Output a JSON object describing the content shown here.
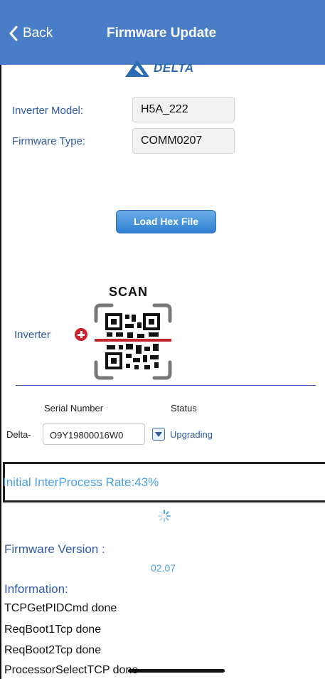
{
  "nav": {
    "back_label": "Back",
    "title": "Firmware Update",
    "bg_color": "#4a7dc8"
  },
  "logo": {
    "text": "DELTA"
  },
  "form": {
    "inverter_model_label": "Inverter Model:",
    "inverter_model_value": "H5A_222",
    "firmware_type_label": "Firmware Type:",
    "firmware_type_value": "COMM0207"
  },
  "load_button": "Load Hex File",
  "scan": {
    "title": "SCAN",
    "inverter_label": "Inverter"
  },
  "table": {
    "serial_header": "Serial Number",
    "status_header": "Status",
    "prefix": "Delta-",
    "serial_value": "O9Y19800016W0",
    "status_value": "Upgrading"
  },
  "progress": {
    "text": "Initial InterProcess Rate:43%",
    "percent": 43
  },
  "firmware_version": {
    "label": "Firmware Version :",
    "value": "02.07"
  },
  "information": {
    "label": "Information:",
    "lines": [
      "TCPGetPIDCmd done",
      "ReqBoot1Tcp done",
      "ReqBoot2Tcp done",
      "ProcessorSelectTCP done"
    ]
  },
  "colors": {
    "accent_blue": "#2e5aa6",
    "light_blue": "#4a9fe0",
    "scan_red": "#d0202a"
  },
  "icons": {
    "back": "chevron-left-icon",
    "add": "plus-circle-icon",
    "dropdown": "chevron-down-icon",
    "loading": "spinner-icon",
    "qr": "qr-code-icon"
  }
}
